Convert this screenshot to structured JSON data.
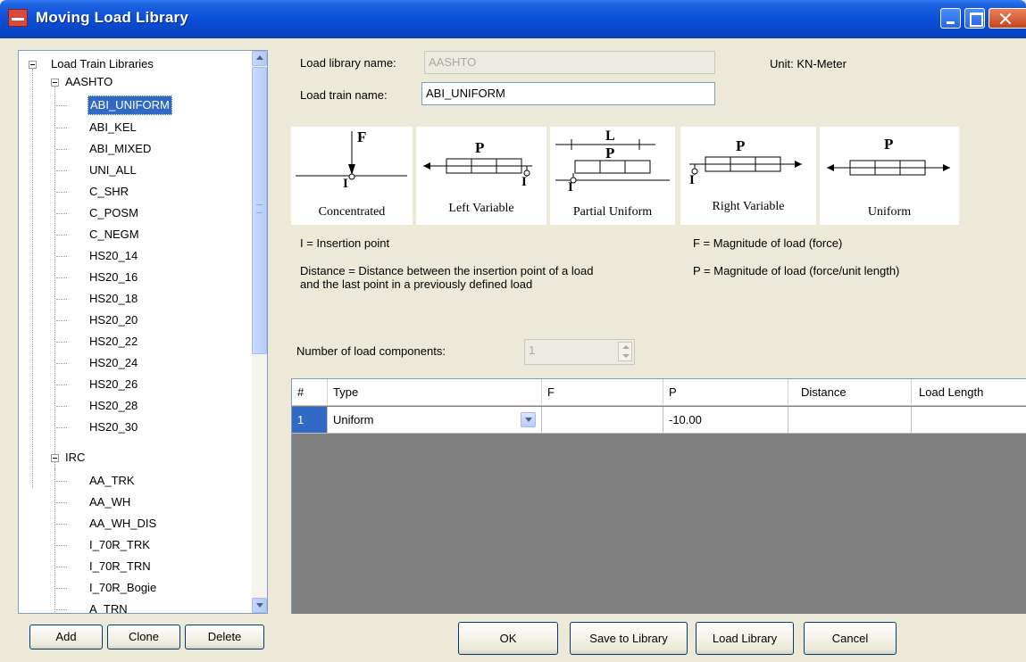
{
  "window": {
    "title": "Moving Load Library"
  },
  "tree": {
    "root_label": "Load Train Libraries",
    "groups": [
      {
        "label": "AASHTO",
        "items": [
          "ABI_UNIFORM",
          "ABI_KEL",
          "ABI_MIXED",
          "UNI_ALL",
          "C_SHR",
          "C_POSM",
          "C_NEGM",
          "HS20_14",
          "HS20_16",
          "HS20_18",
          "HS20_20",
          "HS20_22",
          "HS20_24",
          "HS20_26",
          "HS20_28",
          "HS20_30"
        ]
      },
      {
        "label": "IRC",
        "items": [
          "AA_TRK",
          "AA_WH",
          "AA_WH_DIS",
          "I_70R_TRK",
          "I_70R_TRN",
          "I_70R_Bogie",
          "A_TRN"
        ]
      }
    ],
    "selected": "ABI_UNIFORM"
  },
  "form": {
    "library_name_label": "Load library name:",
    "library_name_value": "AASHTO",
    "train_name_label": "Load train name:",
    "train_name_value": "ABI_UNIFORM",
    "unit_text": "Unit:  KN-Meter",
    "num_components_label": "Number of load components:",
    "num_components_value": "1"
  },
  "diagrams": {
    "concentrated": {
      "caption": "Concentrated",
      "symbol": "F",
      "point": "I"
    },
    "left_variable": {
      "caption": "Left Variable",
      "symbol": "P",
      "point": "I"
    },
    "partial_uniform": {
      "caption": "Partial Uniform",
      "symbol": "P",
      "length": "L",
      "point": "I"
    },
    "right_variable": {
      "caption": "Right Variable",
      "symbol": "P",
      "point": "I"
    },
    "uniform": {
      "caption": "Uniform",
      "symbol": "P"
    }
  },
  "legend": {
    "insertion": "I = Insertion point",
    "distance_line1": "Distance = Distance between the insertion point of a load",
    "distance_line2": "and the last point in a previously defined load",
    "force": "F = Magnitude of load (force)",
    "distributed": "P = Magnitude of load (force/unit length)"
  },
  "grid": {
    "columns": [
      "#",
      "Type",
      "F",
      "P",
      "Distance",
      "Load Length"
    ],
    "rows": [
      {
        "num": "1",
        "type": "Uniform",
        "f": "",
        "p": "-10.00",
        "distance": "",
        "length": ""
      }
    ]
  },
  "buttons": {
    "add": "Add",
    "clone": "Clone",
    "delete": "Delete",
    "ok": "OK",
    "save": "Save to Library",
    "load": "Load Library",
    "cancel": "Cancel"
  },
  "colors": {
    "titlebar": "#0a4fd8",
    "selection": "#316ac5",
    "dialog_bg": "#ece9d8",
    "grid_bg": "#808080"
  }
}
